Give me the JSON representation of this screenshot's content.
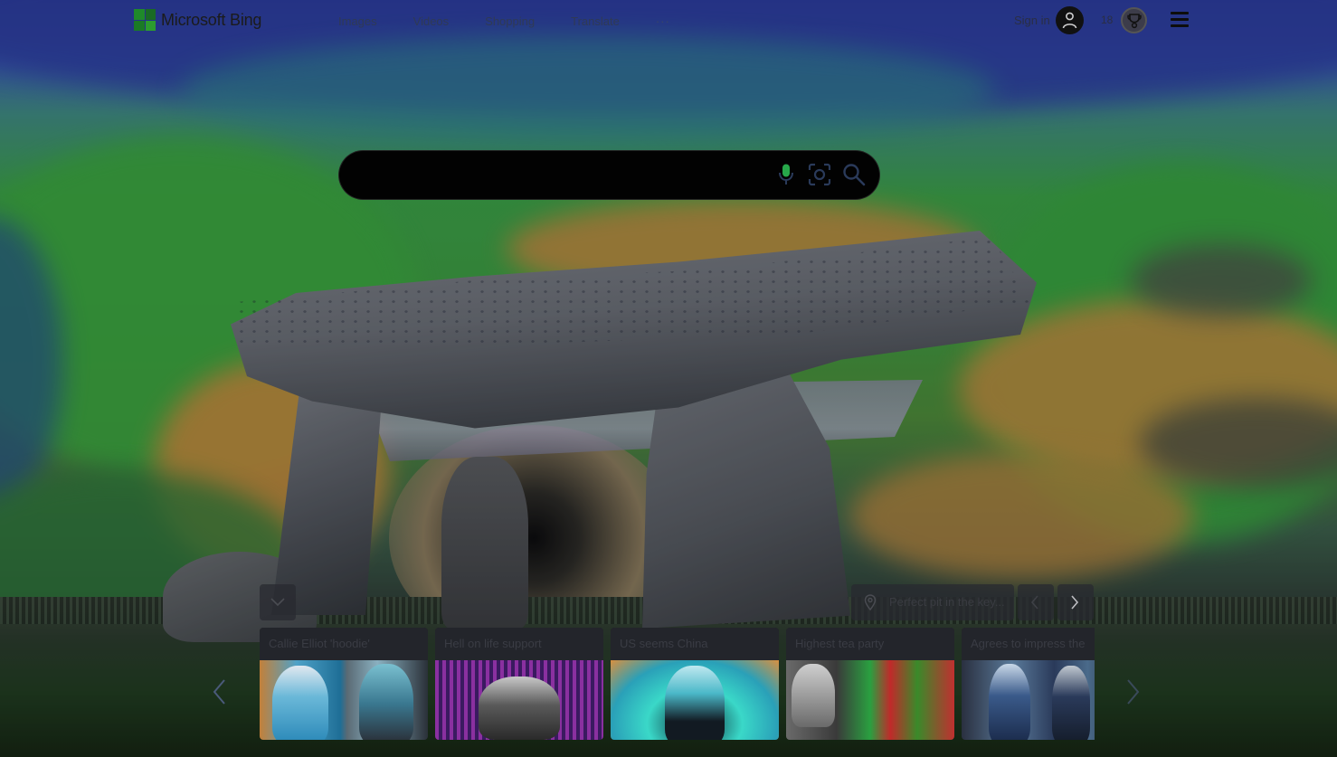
{
  "brand": {
    "name": "Microsoft Bing"
  },
  "nav": {
    "links": [
      "Images",
      "Videos",
      "Shopping",
      "Translate"
    ],
    "more_label": "···"
  },
  "account": {
    "sign_in_label": "Sign in",
    "points": "18"
  },
  "search": {
    "value": "",
    "placeholder": ""
  },
  "location": {
    "text": "Perfect pit in the key..."
  },
  "news": [
    {
      "title": "Callie Elliot 'hoodie'"
    },
    {
      "title": "Hell on life support"
    },
    {
      "title": "US seems China"
    },
    {
      "title": "Highest tea party"
    },
    {
      "title": "Agrees to impress the"
    }
  ],
  "icons": {
    "logo": "bing-logo-icon",
    "avatar": "user-avatar-icon",
    "rewards": "rewards-trophy-icon",
    "menu": "hamburger-menu-icon",
    "mic": "microphone-icon",
    "visual": "visual-search-icon",
    "search": "search-icon",
    "location": "location-pin-icon"
  }
}
